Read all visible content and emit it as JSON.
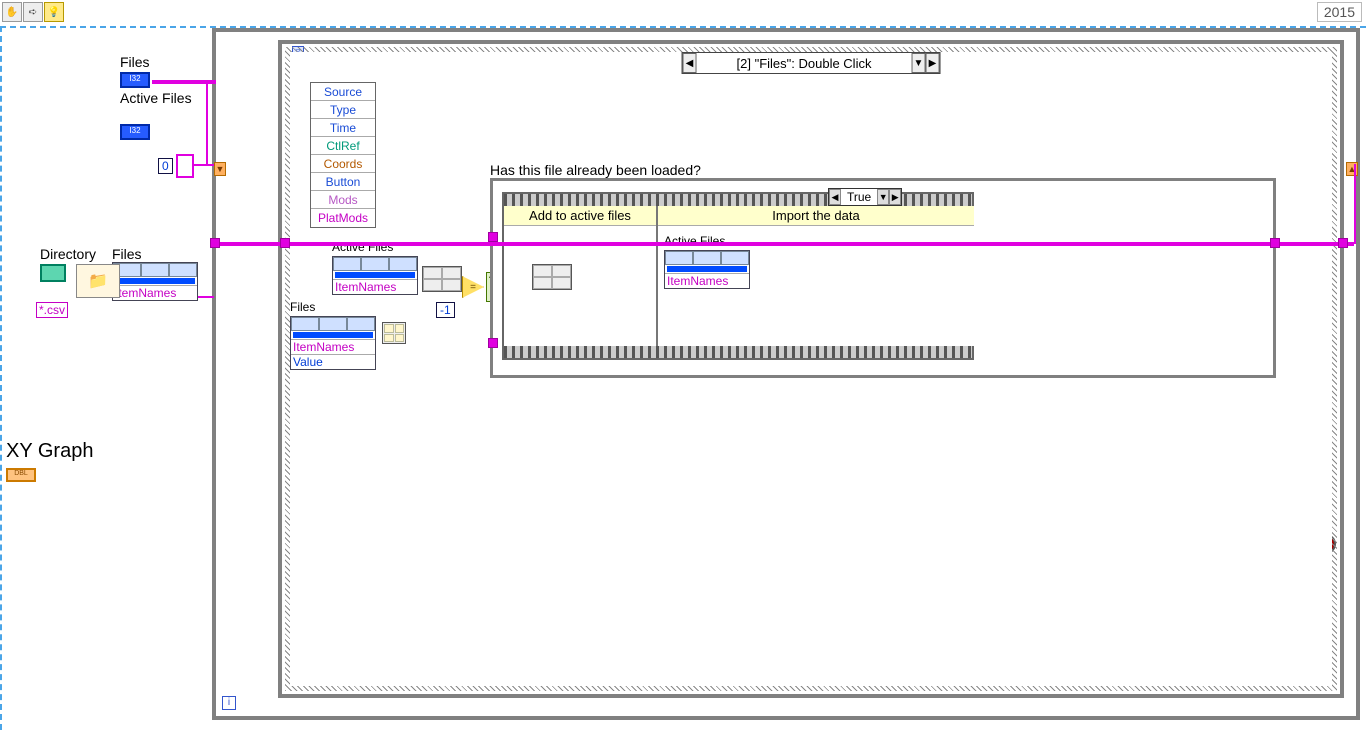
{
  "toolbar": {
    "hand": "✋",
    "run": "➪",
    "highlight": "💡"
  },
  "version": "2015",
  "controls": {
    "files_label": "Files",
    "activefiles_label": "Active Files",
    "index_const": "0",
    "directory_label": "Directory",
    "files2_label": "Files",
    "csv_const": "*.csv",
    "xygraph_label": "XY Graph"
  },
  "event_case": "[2] \"Files\": Double Click",
  "unbundle": [
    "Source",
    "Type",
    "Time",
    "CtlRef",
    "Coords",
    "Button",
    "Mods",
    "PlatMods"
  ],
  "mid": {
    "activefiles": "Active Files",
    "itemnames": "ItemNames",
    "files": "Files",
    "value": "Value",
    "minus1": "-1",
    "eq": "="
  },
  "case2": {
    "question": "Has this file already been loaded?",
    "true": "True",
    "frame1": "Add to active files",
    "frame2": "Import the data",
    "frame2_active": "Active Files",
    "frame2_itemnames": "ItemNames"
  },
  "loop": {
    "hourglass": "⧖",
    "i": "i"
  }
}
